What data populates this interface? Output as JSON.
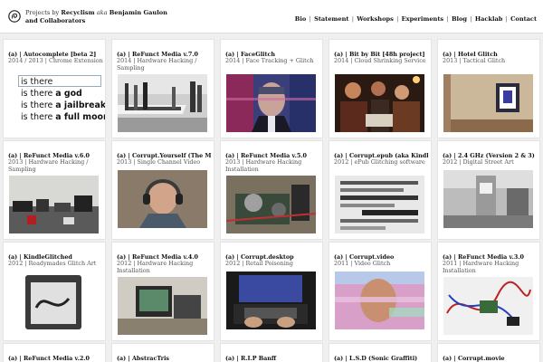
{
  "header": {
    "title_prefix": "Projects by",
    "title_brand": "Recyclism",
    "title_aka": "aka",
    "title_name": "Benjamin Gaulon",
    "title_line2": "and Collaborators",
    "nav": [
      "Bio",
      "Statement",
      "Workshops",
      "Experiments",
      "Blog",
      "Hacklab",
      "Contact"
    ],
    "nav_sep": "|"
  },
  "autocomplete": {
    "input": "is there",
    "suggestions": [
      {
        "plain": "is there ",
        "bold": "a god"
      },
      {
        "plain": "is there ",
        "bold": "a jailbreak fo"
      },
      {
        "plain": "is there ",
        "bold": "a full moon"
      }
    ]
  },
  "cards": [
    {
      "title": "(a) | Autocomplete [beta 2]",
      "meta": "2014 / 2013 | Chrome Extension"
    },
    {
      "title": "(a) | ReFunct Media v.7.0",
      "meta": "2014 | Hardware Hacking / Sampling"
    },
    {
      "title": "(a) | FaceGlitch",
      "meta": "2014 | Face Tracking + Glitch"
    },
    {
      "title": "(a) | Bit by Bit [48h project]",
      "meta": "2014 | Cloud Shrinking Service"
    },
    {
      "title": "(a) | Hotel Glitch",
      "meta": "2013 | Tactical Glitch"
    },
    {
      "title": "(a) | ReFunct Media v.6.0",
      "meta": "2013 | Hardware Hacking / Sampling"
    },
    {
      "title": "(a) | Corrupt.Yourself (The Movie)",
      "meta": "2013 | Single Channel Video"
    },
    {
      "title": "(a) | ReFunct Media v.5.0",
      "meta": "2013 | Hardware Hacking Installation"
    },
    {
      "title": "(a) | Corrupt.epub (aka KindleGlitcher)",
      "meta": "2012 | ePub Glitching software"
    },
    {
      "title": "(a) | 2.4 GHz (Version 2 & 3)",
      "meta": "2012 | Digital Street Art"
    },
    {
      "title": "(a) | KindleGlitched",
      "meta": "2012 | Readymades Glitch Art"
    },
    {
      "title": "(a) | ReFunct Media v.4.0",
      "meta": "2012 | Hardware Hacking Installation"
    },
    {
      "title": "(a) | Corrupt.desktop",
      "meta": "2012 | Retail Poisoning"
    },
    {
      "title": "(a) | Corrupt.video",
      "meta": "2011 | Video Glitch"
    },
    {
      "title": "(a) | ReFunct Media v.3.0",
      "meta": "2011 | Hardware Hacking Installation"
    },
    {
      "title": "(a) | ReFunct Media v.2.0",
      "meta": ""
    },
    {
      "title": "(a) | AbstracTris",
      "meta": ""
    },
    {
      "title": "(a) | R.I.P Banff",
      "meta": ""
    },
    {
      "title": "(a) | L.S.D (Sonic Graffiti)",
      "meta": ""
    },
    {
      "title": "(a) | Corrupt.movie",
      "meta": ""
    }
  ],
  "thumb_icons": [
    "autocomplete-screenshot",
    "exhibition-photo",
    "face-glitch-photo",
    "people-laptop-photo",
    "hotel-room-photo",
    "hardware-table-photo",
    "headphones-portrait-photo",
    "circuit-device-photo",
    "glitched-text-photo",
    "street-router-photo",
    "kindle-photo",
    "crt-monitor-photo",
    "laptop-keyboard-photo",
    "glitched-face-photo",
    "cables-circuit-photo"
  ]
}
